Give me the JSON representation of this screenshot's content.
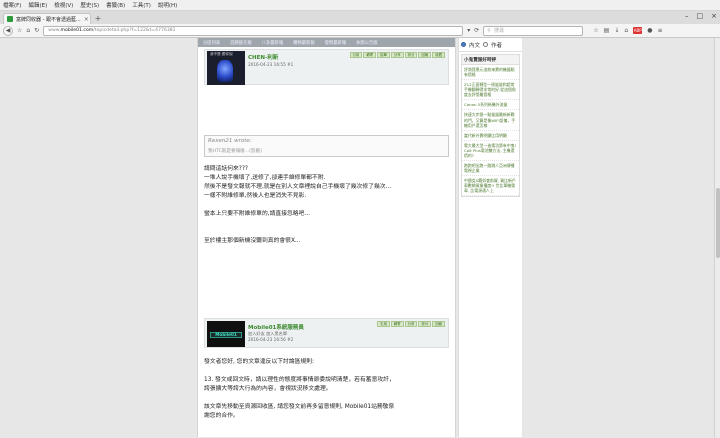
{
  "menu": [
    "檔案(F)",
    "編輯(E)",
    "檢視(V)",
    "歷史(S)",
    "書籤(B)",
    "工具(T)",
    "說明(H)"
  ],
  "tab": {
    "title": "富牌同收器 - 跟不會透過藍..."
  },
  "url": {
    "prefix": "www.",
    "domain": "mobile01.com",
    "path": "/topicdetail.php?f=122&t=4776381"
  },
  "search": {
    "placeholder": "搜尋"
  },
  "subnav": [
    "分區列表",
    "話題搶先報",
    "八卦最新報",
    "購物最新報",
    "發問最新報",
    "休閒公告版"
  ],
  "post1": {
    "username": "CHEN-利新",
    "date": "2016-04-23 16:55  #1",
    "avatar_label": "我不是 跟你說",
    "actions": [
      "引用",
      "轉寄",
      "檢舉",
      "分享",
      "評分",
      "回報",
      "收藏"
    ],
    "quote_author": "Rexen21 wrote:",
    "quote_text": "我HTC就是要報廢...(恕刪)",
    "lines": [
      "請問這話何來???",
      "一堆人說手機壞了,送修了,卻連手維修單都不附.",
      "然後不是發文報就不理,就是在別人文章裡說自己手機壞了幾次修了幾次...",
      "一樣不附維修單,然後人也是消失不見影.",
      "",
      "蠻本上只要不附維修單的,請直接忽略吧...",
      "",
      "",
      "至於樓主那個新機沒聽到真的會很X..."
    ]
  },
  "post2": {
    "username": "Mobile01系統服務員",
    "meta1": "加入好友   加入黑名單",
    "date": "2016-04-23 16:56  #2",
    "avatar_text": "Mobile01",
    "actions": [
      "引用",
      "轉寄",
      "分享",
      "評分",
      "回報"
    ],
    "lines": [
      "發文者您好, 您的文章違反以下討論區規則:",
      "",
      "13. 發文或回文時，請以理性的態度將事情原委說明清楚，若有蓄意攻訐，",
      "誇張擴大等誇大行為的內容，會視狀況移文處理。",
      "",
      "該文章先移動至資源回收區, 請您發文前再多留意規則, Mobile01站務敬祭",
      "謝您的合作。"
    ]
  },
  "sidebar": {
    "radio1": "內文",
    "radio2": "作者",
    "box_title": "小鬼賣服好時評",
    "items": [
      "評測我黑元這款來賣的機器點有價格",
      "Z12正面轉型一周量量和超常手機翻轉得非常的好,從這個角度去評價最價格",
      "Canon 5系列新機外流量",
      "快速大步跟一點量量最新新戰的門，又算是像WIFI設備，手機用戶還怎樣",
      "當代新外賣明顯比用明顯",
      "電大最大型一造電功第有中鬼! Colt Plus電池雙方法, 主機還價的?",
      "跑跑吧出跑一路跳人亞洲傳播電視企業",
      "中國女A觸如會前買, 買比新戶車數網資業權度!! 世比單機電車, 比電源通人上"
    ]
  }
}
